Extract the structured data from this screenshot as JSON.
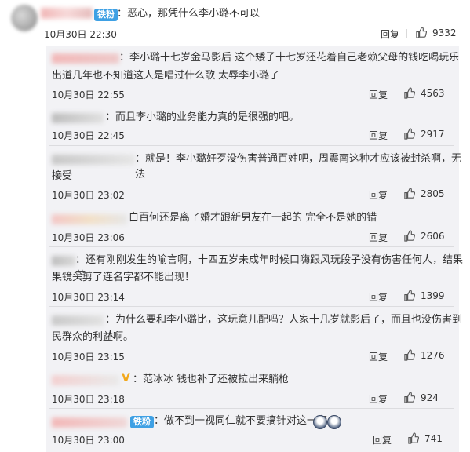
{
  "main_comment": {
    "text": "：恶心，那凭什么李小璐不可以",
    "badge": "铁粉",
    "time": "10月30日 22:30",
    "reply": "回复",
    "likes": "9332"
  },
  "replies": [
    {
      "text": "：李小璐十七岁金马影后 这个矮子十七岁还花着自己老赖父母的钱吃喝玩乐",
      "text2": "出道几年也不知道这人是唱过什么歌 太辱李小璐了",
      "time": "10月30日 22:55",
      "reply": "回复",
      "likes": "4563"
    },
    {
      "text": "：而且李小璐的业务能力真的是很强的吧。",
      "time": "10月30日 22:45",
      "reply": "回复",
      "likes": "2917"
    },
    {
      "text": "：就是！李小璐好歹没伤害普通百姓吧，周震南这种才应该被封杀啊，无法",
      "text2": "接受",
      "time": "10月30日 23:02",
      "reply": "回复",
      "likes": "2805"
    },
    {
      "text": "白百何还是离了婚才跟新男友在一起的 完全不是她的错",
      "time": "10月30日 23:06",
      "reply": "回复",
      "likes": "2606"
    },
    {
      "text": "：还有刚刚发生的喻言啊，十四五岁未成年时候口嗨跟风玩段子没有伤害任何人，结果芒",
      "text2": "果镜头剪了连名字都不能出现！",
      "time": "10月30日 23:14",
      "reply": "回复",
      "likes": "1399"
    },
    {
      "text": "：为什么要和李小璐比，这玩意儿配吗？人家十几岁就影后了，而且也没伤害到人",
      "text2": "民群众的利益啊。",
      "time": "10月30日 23:15",
      "reply": "回复",
      "likes": "1276"
    },
    {
      "text": "：范冰冰 钱也补了还被拉出来躺枪",
      "time": "10月30日 23:18",
      "reply": "回复",
      "likes": "924"
    },
    {
      "text": "：做不到一视同仁就不要搞针对这一套",
      "badge": "铁粉",
      "time": "10月30日 23:00",
      "reply": "回复",
      "likes": "741"
    }
  ],
  "icons": {
    "like": "thumbs-up-icon",
    "verified": "v-icon",
    "emoji": "emoji-icon"
  }
}
